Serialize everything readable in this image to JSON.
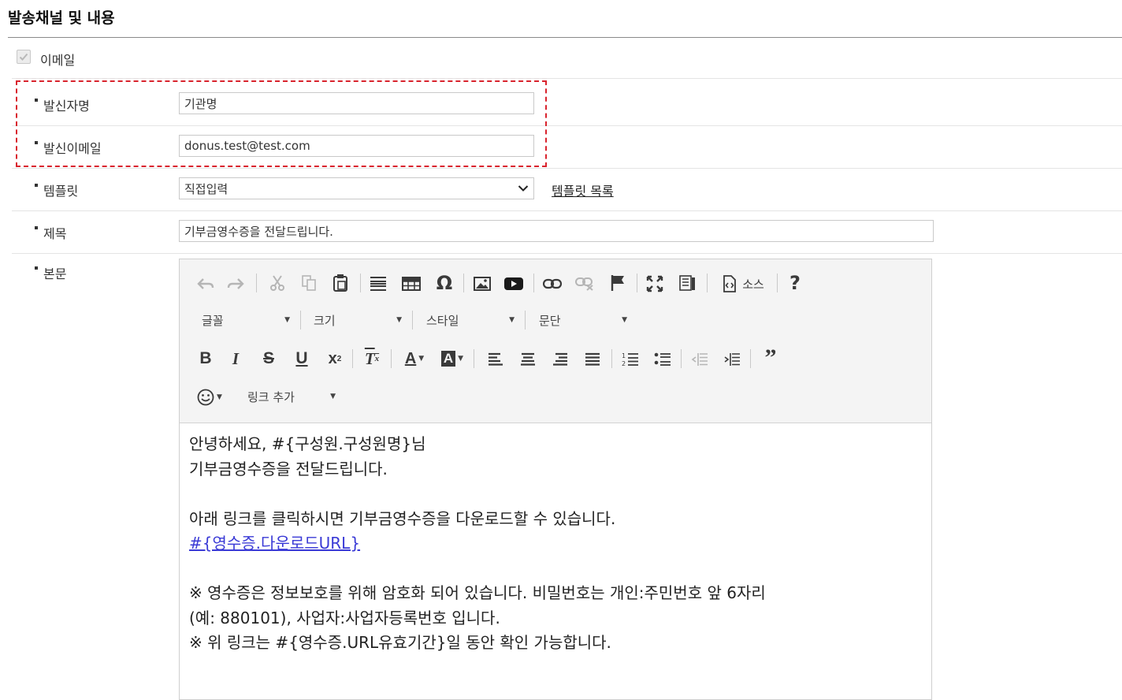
{
  "section_title": "발송채널 및 내용",
  "channel": {
    "label": "이메일",
    "checked": true
  },
  "sender_name": {
    "label": "발신자명",
    "value": "기관명"
  },
  "sender_email": {
    "label": "발신이메일",
    "value": "donus.test@test.com"
  },
  "template": {
    "label": "템플릿",
    "selected": "직접입력",
    "list_link": "템플릿 목록"
  },
  "subject": {
    "label": "제목",
    "value": "기부금영수증을 전달드립니다."
  },
  "body": {
    "label": "본문",
    "toolbar": {
      "source_label": "소스",
      "help_label": "?",
      "font_label": "글꼴",
      "size_label": "크기",
      "style_label": "스타일",
      "format_label": "문단",
      "link_add_label": "링크 추가"
    },
    "content": {
      "line1": "안녕하세요, #{구성원.구성원명}님",
      "line2": "기부금영수증을 전달드립니다.",
      "line3": "아래 링크를 클릭하시면 기부금영수증을 다운로드할 수 있습니다.",
      "link": "#{영수증.다운로드URL}",
      "line4": "※ 영수증은 정보보호를 위해 암호화 되어 있습니다. 비밀번호는 개인:주민번호 앞 6자리",
      "line5": "(예: 880101), 사업자:사업자등록번호 입니다.",
      "line6": "※ 위 링크는 #{영수증.URL유효기간}일 동안 확인 가능합니다."
    }
  },
  "colors": {
    "highlight_border": "#d9232d",
    "link": "#3a3ad6"
  }
}
